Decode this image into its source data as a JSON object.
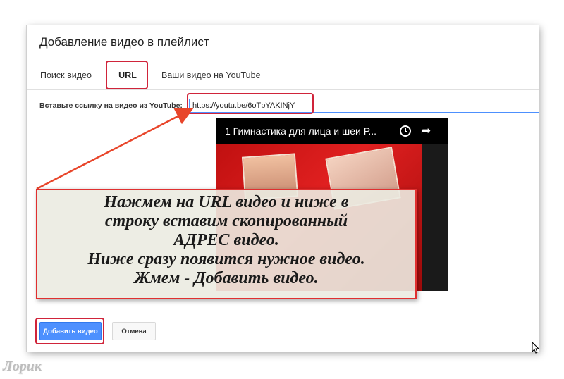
{
  "dialog": {
    "title": "Добавление видео в плейлист"
  },
  "tabs": [
    {
      "label": "Поиск видео"
    },
    {
      "label": "URL",
      "active": true
    },
    {
      "label": "Ваши видео на YouTube"
    }
  ],
  "url_field": {
    "label": "Вставьте ссылку на видео из YouTube:",
    "value": "https://youtu.be/6oTbYAKINjY"
  },
  "video_preview": {
    "title": "1 Гимнастика для лица и шеи Р...",
    "clock_icon": "clock-icon",
    "share_icon": "share-icon"
  },
  "annotation": {
    "lines": [
      "Нажмем на URL видео и  ниже в",
      "строку вставим скопированный",
      "АДРЕС видео.",
      "Ниже сразу появится нужное видео.",
      "Жмем - Добавить видео."
    ],
    "border_color": "#e03030"
  },
  "buttons": {
    "add": "Добавить видео",
    "cancel": "Отмена"
  },
  "watermark": "Лорик",
  "colors": {
    "accent": "#4d90fe",
    "highlight": "#d0243a"
  }
}
